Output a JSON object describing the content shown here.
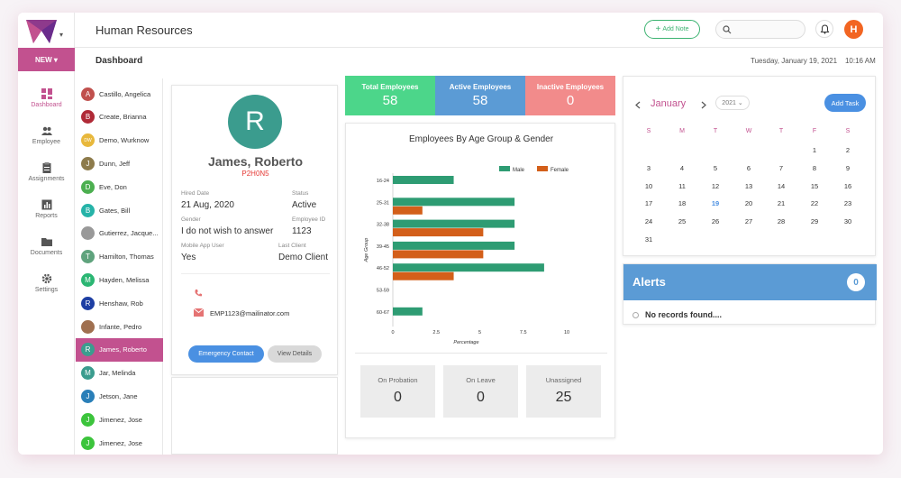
{
  "header": {
    "app_title": "Human Resources",
    "add_note": "Add Note",
    "avatar_initial": "H",
    "page_title": "Dashboard",
    "date": "Tuesday, January 19, 2021",
    "time": "10:16 AM"
  },
  "nav": {
    "new_label": "NEW",
    "items": [
      {
        "label": "Dashboard",
        "icon": "dashboard-icon"
      },
      {
        "label": "Employee",
        "icon": "people-icon"
      },
      {
        "label": "Assignments",
        "icon": "clipboard-icon"
      },
      {
        "label": "Reports",
        "icon": "chart-icon"
      },
      {
        "label": "Documents",
        "icon": "folder-icon"
      },
      {
        "label": "Settings",
        "icon": "gear-icon"
      }
    ]
  },
  "employees": [
    {
      "name": "Castillo, Angelica",
      "initial": "A",
      "color": "#c0504d"
    },
    {
      "name": "Create, Brianna",
      "initial": "B",
      "color": "#b02a37"
    },
    {
      "name": "Demo, Wurknow",
      "initial": "DW",
      "color": "#e8b83c"
    },
    {
      "name": "Dunn, Jeff",
      "initial": "J",
      "color": "#8d7b4b"
    },
    {
      "name": "Eve, Don",
      "initial": "D",
      "color": "#4caf50"
    },
    {
      "name": "Gates, Bill",
      "initial": "B",
      "color": "#26b3a8"
    },
    {
      "name": "Gutierrez, Jacque...",
      "initial": "",
      "color": "#999999"
    },
    {
      "name": "Hamilton, Thomas",
      "initial": "T",
      "color": "#5fa37d"
    },
    {
      "name": "Hayden, Melissa",
      "initial": "M",
      "color": "#2bb673"
    },
    {
      "name": "Henshaw, Rob",
      "initial": "R",
      "color": "#1e3fa3"
    },
    {
      "name": "Infante, Pedro",
      "initial": "",
      "color": "#a07050"
    },
    {
      "name": "James, Roberto",
      "initial": "R",
      "color": "#3b9c8e"
    },
    {
      "name": "Jar, Melinda",
      "initial": "M",
      "color": "#3b9c8e"
    },
    {
      "name": "Jetson, Jane",
      "initial": "J",
      "color": "#2a7fb8"
    },
    {
      "name": "Jimenez, Jose",
      "initial": "J",
      "color": "#3cc43c"
    },
    {
      "name": "Jimenez, Jose",
      "initial": "J",
      "color": "#3cc43c"
    }
  ],
  "profile": {
    "initial": "R",
    "name": "James, Roberto",
    "code": "P2H0N5",
    "hired_label": "Hired Date",
    "hired": "21 Aug, 2020",
    "status_label": "Status",
    "status": "Active",
    "gender_label": "Gender",
    "gender": "I do not wish to answer",
    "empid_label": "Employee ID",
    "empid": "1123",
    "mobile_label": "Mobile App User",
    "mobile": "Yes",
    "lastclient_label": "Last Client",
    "lastclient": "Demo Client",
    "email": "EMP1123@mailinator.com",
    "emergency_btn": "Emergency Contact",
    "details_btn": "View Details"
  },
  "stats": [
    {
      "label": "Total Employees",
      "value": "58",
      "color": "#4cd68a"
    },
    {
      "label": "Active Employees",
      "value": "58",
      "color": "#5b9bd5"
    },
    {
      "label": "Inactive Employees",
      "value": "0",
      "color": "#f28b8b"
    }
  ],
  "chart_data": {
    "type": "bar",
    "orientation": "horizontal",
    "title": "Employees By Age Group & Gender",
    "xlabel": "Percentage",
    "ylabel": "Age Group",
    "categories": [
      "16-24",
      "25-31",
      "32-38",
      "39-45",
      "46-52",
      "53-59",
      "60-67"
    ],
    "series": [
      {
        "name": "Male",
        "color": "#2e9c73",
        "values": [
          3.5,
          7,
          7,
          7,
          8.7,
          0,
          1.7
        ]
      },
      {
        "name": "Female",
        "color": "#d35f1a",
        "values": [
          0,
          1.7,
          5.2,
          5.2,
          3.5,
          0,
          0
        ]
      }
    ],
    "xlim": [
      0,
      10
    ],
    "xticks": [
      "0",
      "2.5",
      "5",
      "7.5",
      "10"
    ],
    "legend": "top-right"
  },
  "substats": [
    {
      "label": "On Probation",
      "value": "0"
    },
    {
      "label": "On Leave",
      "value": "0"
    },
    {
      "label": "Unassigned",
      "value": "25"
    }
  ],
  "calendar": {
    "month": "January",
    "year": "2021",
    "add_task": "Add Task",
    "days": [
      "S",
      "M",
      "T",
      "W",
      "T",
      "F",
      "S"
    ],
    "weeks": [
      [
        "",
        "",
        "",
        "",
        "",
        "1",
        "2"
      ],
      [
        "3",
        "4",
        "5",
        "6",
        "7",
        "8",
        "9"
      ],
      [
        "10",
        "11",
        "12",
        "13",
        "14",
        "15",
        "16"
      ],
      [
        "17",
        "18",
        "19",
        "20",
        "21",
        "22",
        "23"
      ],
      [
        "24",
        "25",
        "26",
        "27",
        "28",
        "29",
        "30"
      ],
      [
        "31",
        "",
        "",
        "",
        "",
        "",
        ""
      ]
    ],
    "today": "19"
  },
  "alerts": {
    "title": "Alerts",
    "count": "0",
    "message": "No records found...."
  }
}
